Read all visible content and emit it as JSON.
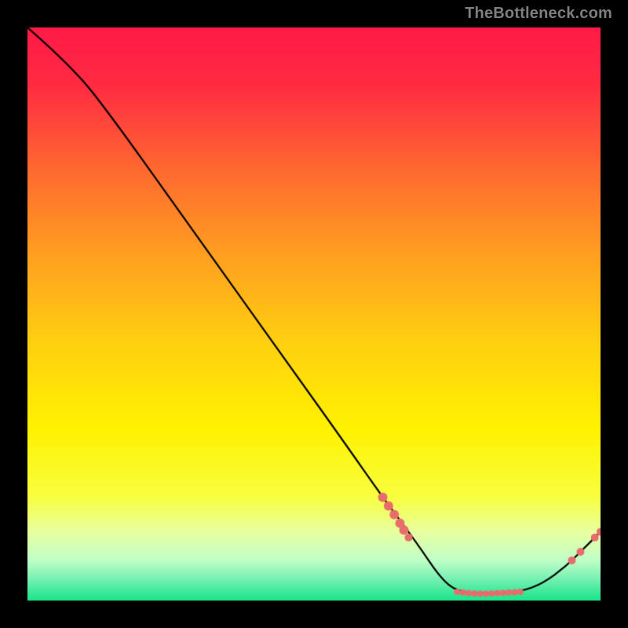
{
  "watermark": "TheBottleneck.com",
  "chart_data": {
    "type": "line",
    "title": "",
    "xlabel": "",
    "ylabel": "",
    "xlim": [
      0,
      100
    ],
    "ylim": [
      0,
      100
    ],
    "grid": false,
    "legend": false,
    "gradient_stops": [
      {
        "pos": 0.0,
        "color": "#ff1a46"
      },
      {
        "pos": 0.1,
        "color": "#ff2b42"
      },
      {
        "pos": 0.25,
        "color": "#ff6a30"
      },
      {
        "pos": 0.4,
        "color": "#ffa020"
      },
      {
        "pos": 0.55,
        "color": "#ffd010"
      },
      {
        "pos": 0.7,
        "color": "#fff200"
      },
      {
        "pos": 0.82,
        "color": "#f8ff40"
      },
      {
        "pos": 0.88,
        "color": "#e8ffa0"
      },
      {
        "pos": 0.93,
        "color": "#c0ffc8"
      },
      {
        "pos": 0.965,
        "color": "#70f0b0"
      },
      {
        "pos": 1.0,
        "color": "#18e588"
      }
    ],
    "curve": {
      "color": "#000000",
      "width": 2.2,
      "points": [
        {
          "x": 0,
          "y": 100
        },
        {
          "x": 8,
          "y": 93
        },
        {
          "x": 15,
          "y": 84
        },
        {
          "x": 25,
          "y": 70
        },
        {
          "x": 35,
          "y": 56
        },
        {
          "x": 45,
          "y": 42
        },
        {
          "x": 55,
          "y": 28
        },
        {
          "x": 62,
          "y": 18
        },
        {
          "x": 68,
          "y": 10
        },
        {
          "x": 72,
          "y": 4
        },
        {
          "x": 75,
          "y": 1.5
        },
        {
          "x": 80,
          "y": 1.2
        },
        {
          "x": 86,
          "y": 1.5
        },
        {
          "x": 90,
          "y": 3
        },
        {
          "x": 94,
          "y": 6
        },
        {
          "x": 97,
          "y": 9
        },
        {
          "x": 100,
          "y": 12
        }
      ]
    },
    "markers": {
      "color": "#e76d6d",
      "radius_large": 6,
      "radius_small": 4,
      "points": [
        {
          "x": 62,
          "y": 18,
          "r": 6
        },
        {
          "x": 63,
          "y": 16.5,
          "r": 6
        },
        {
          "x": 64,
          "y": 15,
          "r": 6
        },
        {
          "x": 65,
          "y": 13.5,
          "r": 6
        },
        {
          "x": 65.7,
          "y": 12.3,
          "r": 6
        },
        {
          "x": 66.5,
          "y": 11,
          "r": 5
        },
        {
          "x": 75,
          "y": 1.5,
          "r": 4
        },
        {
          "x": 76,
          "y": 1.4,
          "r": 4
        },
        {
          "x": 77,
          "y": 1.3,
          "r": 4
        },
        {
          "x": 78,
          "y": 1.25,
          "r": 4
        },
        {
          "x": 79,
          "y": 1.2,
          "r": 4
        },
        {
          "x": 80,
          "y": 1.2,
          "r": 4
        },
        {
          "x": 81,
          "y": 1.25,
          "r": 4
        },
        {
          "x": 82,
          "y": 1.3,
          "r": 4
        },
        {
          "x": 83,
          "y": 1.35,
          "r": 4
        },
        {
          "x": 84,
          "y": 1.4,
          "r": 4
        },
        {
          "x": 85,
          "y": 1.45,
          "r": 4
        },
        {
          "x": 86,
          "y": 1.5,
          "r": 4
        },
        {
          "x": 95,
          "y": 7,
          "r": 5
        },
        {
          "x": 96.5,
          "y": 8.5,
          "r": 5
        },
        {
          "x": 99,
          "y": 11,
          "r": 5
        },
        {
          "x": 100,
          "y": 12,
          "r": 5
        }
      ]
    }
  }
}
